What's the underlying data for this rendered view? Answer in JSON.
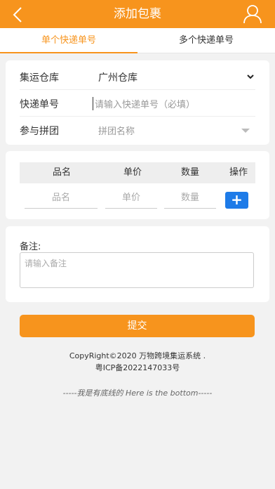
{
  "header": {
    "title": "添加包裹",
    "back_icon": "chevron-left-icon",
    "user_icon": "user-icon"
  },
  "tabs": [
    {
      "label": "单个快递单号",
      "active": true
    },
    {
      "label": "多个快递单号",
      "active": false
    }
  ],
  "form": {
    "warehouse": {
      "label": "集运仓库",
      "value": "广州仓库"
    },
    "tracking": {
      "label": "快递单号",
      "placeholder": "请输入快递单号（必填）"
    },
    "group": {
      "label": "参与拼团",
      "placeholder": "拼团名称"
    }
  },
  "items_table": {
    "headers": [
      "品名",
      "单价",
      "数量",
      "操作"
    ],
    "row": {
      "name_placeholder": "品名",
      "price_placeholder": "单价",
      "qty_placeholder": "数量"
    },
    "add_label": "+"
  },
  "note": {
    "label": "备注:",
    "placeholder": "请输入备注"
  },
  "submit_label": "提交",
  "footer": {
    "copyright": "CopyRight©2020 万物跨境集运系统 .",
    "icp": "粤ICP备2022147033号",
    "bottom_text": "-----我是有底线的 Here is the bottom-----"
  },
  "colors": {
    "accent": "#f7941d",
    "button_blue": "#1e7be8"
  }
}
